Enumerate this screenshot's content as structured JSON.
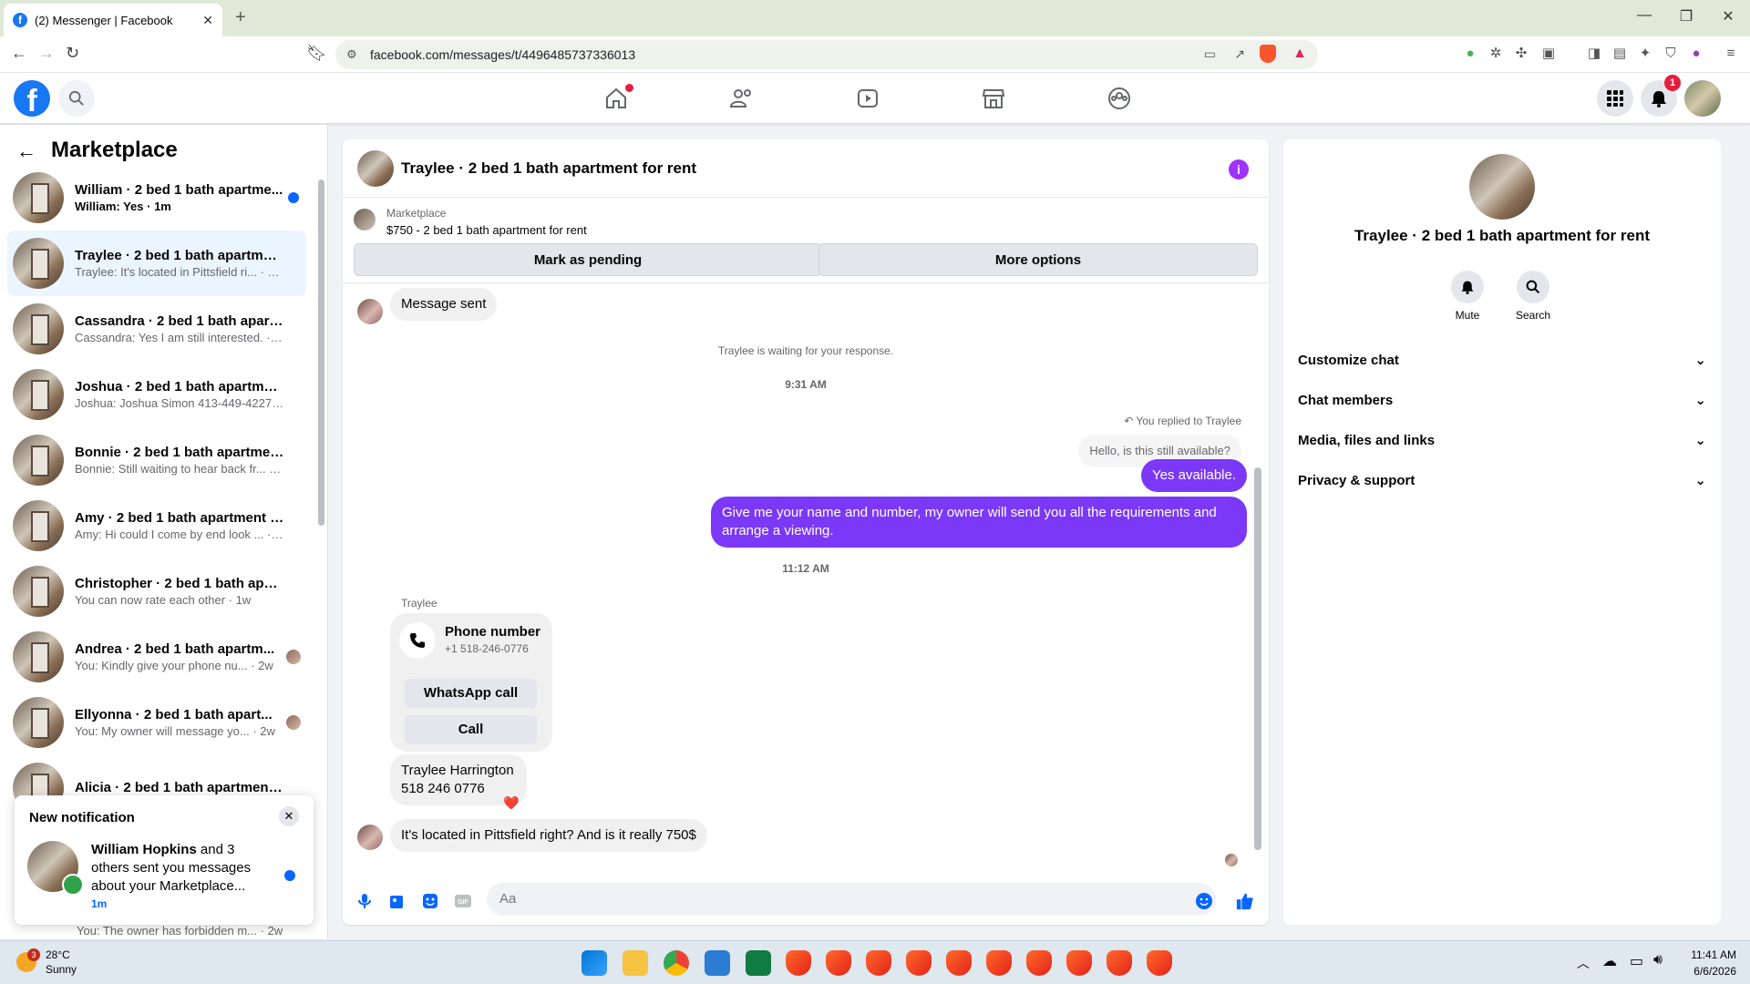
{
  "browser": {
    "tab_title": "(2) Messenger | Facebook",
    "url": "facebook.com/messages/t/4496485737336013"
  },
  "left": {
    "title": "Marketplace",
    "conversations": [
      {
        "name": "William · 2 bed 1 bath apartme...",
        "preview": "William: Yes · 1m",
        "unread": true
      },
      {
        "name": "Traylee · 2 bed 1 bath apartment...",
        "preview": "Traylee: It's located in Pittsfield ri... · 28m",
        "selected": true
      },
      {
        "name": "Cassandra · 2 bed 1 bath apartm...",
        "preview": "Cassandra: Yes I am still interested. · 58m"
      },
      {
        "name": "Joshua · 2 bed 1 bath apartment...",
        "preview": "Joshua: Joshua Simon 413-449-4227 · 2h"
      },
      {
        "name": "Bonnie · 2 bed 1 bath apartment...",
        "preview": "Bonnie: Still waiting to hear back fr... · 4d"
      },
      {
        "name": "Amy · 2 bed 1 bath apartment fo...",
        "preview": "Amy: Hi could I come by end look ... · 1w"
      },
      {
        "name": "Christopher · 2 bed 1 bath apart...",
        "preview": "You can now rate each other · 1w"
      },
      {
        "name": "Andrea · 2 bed 1 bath apartm...",
        "preview": "You: Kindly give your phone nu... · 2w"
      },
      {
        "name": "Ellyonna · 2 bed 1 bath apart...",
        "preview": "You: My owner will message yo... · 2w"
      },
      {
        "name": "Alicia · 2 bed 1 bath apartment f...",
        "preview": ""
      }
    ],
    "last_preview": "You: The owner has forbidden m... · 2w"
  },
  "notification": {
    "title": "New notification",
    "bold_name": "William Hopkins",
    "body": " and 3 others sent you messages about your Marketplace...",
    "time": "1m"
  },
  "chat": {
    "header_title": "Traylee · 2 bed 1 bath apartment for rent",
    "listing_label": "Marketplace",
    "listing_title": "$750 - 2 bed 1 bath apartment for rent",
    "btn_pending": "Mark as pending",
    "btn_more": "More options",
    "msg_sent": "Message sent",
    "waiting": "Traylee is waiting for your response.",
    "time1": "9:31 AM",
    "replied_to": "You replied to Traylee",
    "quoted": "Hello, is this still available?",
    "out1": "Yes available.",
    "out2": "Give me your name and number, my owner will send you all the requirements and arrange a viewing.",
    "time2": "11:12 AM",
    "sender": "Traylee",
    "phone_title": "Phone number",
    "phone_number": "+1 518-246-0776",
    "whatsapp": "WhatsApp call",
    "call": "Call",
    "contact_line1": "Traylee Harrington",
    "contact_line2": "518 246 0776",
    "reaction": "❤️",
    "last_msg": "It's located in Pittsfield right? And is it really 750$",
    "composer_placeholder": "Aa"
  },
  "right": {
    "name": "Traylee · 2 bed 1 bath apartment for rent",
    "mute": "Mute",
    "search": "Search",
    "sections": [
      "Customize chat",
      "Chat members",
      "Media, files and links",
      "Privacy & support"
    ]
  },
  "nav": {
    "notif_count": "1"
  },
  "taskbar": {
    "weather_temp": "28°C",
    "weather_desc": "Sunny",
    "weather_badge": "3",
    "time": "11:41 AM",
    "date": "6/6/2026"
  },
  "colors": {
    "accent": "#1877f2",
    "outgoing_bubble": "#7b38f6"
  }
}
